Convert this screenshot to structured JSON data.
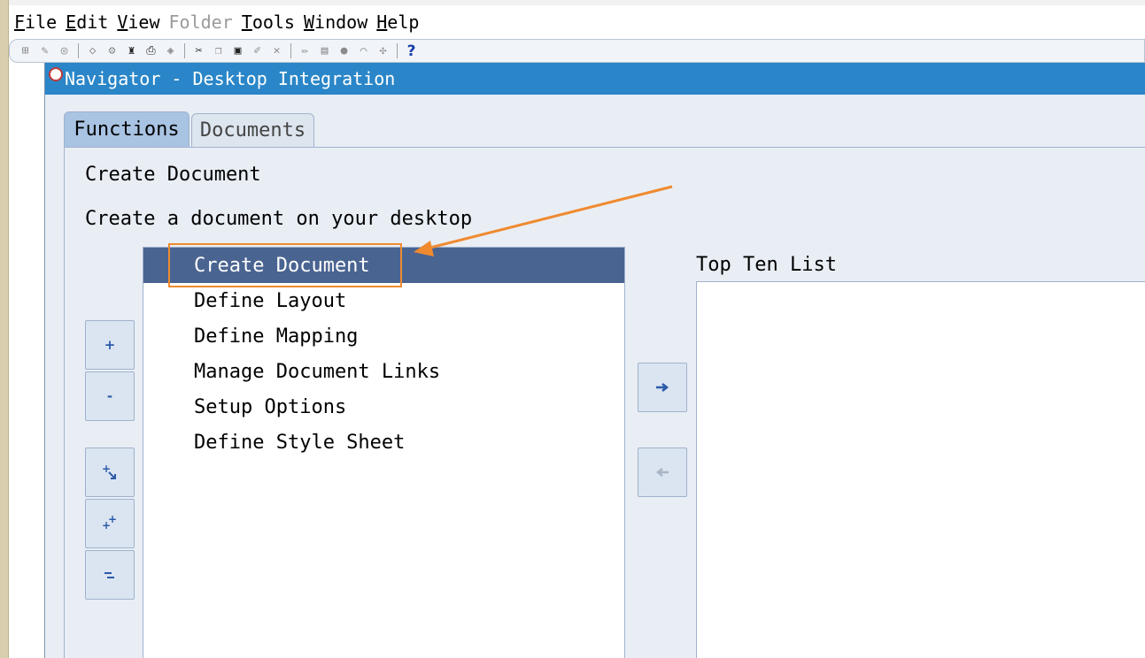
{
  "menubar": {
    "items": [
      {
        "label": "File",
        "underline": "F",
        "rest": "ile",
        "disabled": false
      },
      {
        "label": "Edit",
        "underline": "E",
        "rest": "dit",
        "disabled": false
      },
      {
        "label": "View",
        "underline": "V",
        "rest": "iew",
        "disabled": false
      },
      {
        "label": "Folder",
        "underline": "",
        "rest": "Folder",
        "disabled": true
      },
      {
        "label": "Tools",
        "underline": "T",
        "rest": "ools",
        "disabled": false
      },
      {
        "label": "Window",
        "underline": "W",
        "rest": "indow",
        "disabled": false
      },
      {
        "label": "Help",
        "underline": "H",
        "rest": "elp",
        "disabled": false
      }
    ]
  },
  "toolbar": {
    "help_glyph": "?"
  },
  "window": {
    "title": "Navigator - Desktop Integration"
  },
  "tabs": {
    "functions": "Functions",
    "documents": "Documents"
  },
  "function_panel": {
    "title": "Create Document",
    "description": "Create a document on your desktop",
    "items": [
      "Create Document",
      "Define Layout",
      "Define Mapping",
      "Manage Document Links",
      "Setup Options",
      "Define Style Sheet"
    ],
    "selected_index": 0
  },
  "side_buttons": {
    "expand": "+",
    "collapse": "-"
  },
  "top_ten": {
    "label": "Top Ten List"
  },
  "colors": {
    "titlebar": "#2a86c8",
    "selected_row": "#4a6491",
    "highlight": "#f08a2f"
  }
}
